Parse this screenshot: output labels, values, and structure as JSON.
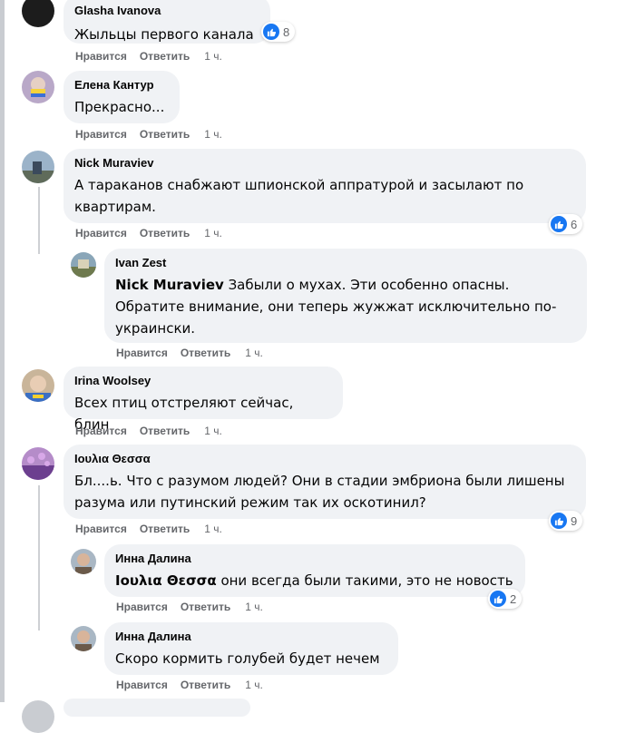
{
  "ui": {
    "like": "Нравится",
    "reply": "Ответить",
    "time": "1 ч."
  },
  "colors": {
    "like_blue": "#1877f2",
    "bubble_bg": "#f0f2f5",
    "meta_gray": "#65676b"
  },
  "comments": [
    {
      "author": "Glasha Ivanova",
      "text": "Жыльцы первого канала",
      "reactions": "8",
      "reaction_icon": "like-icon",
      "time": "1 ч."
    },
    {
      "author": "Елена Кантур",
      "text": "Прекрасно...",
      "time": "1 ч."
    },
    {
      "author": "Nick Muraviev",
      "text": "А тараканов снабжают шпионской аппратурой и засылают по квартирам.",
      "reactions": "6",
      "reaction_icon": "like-icon",
      "time": "1 ч."
    },
    {
      "author": "Ivan Zest",
      "mention": "Nick Muraviev",
      "text": "Забыли о мухах. Эти особенно опасны. Обратите внимание, они теперь жужжат исключительно по-украински.",
      "time": "1 ч."
    },
    {
      "author": "Irina Woolsey",
      "text": "Всех птиц отстреляют сейчас, блин",
      "time": "1 ч."
    },
    {
      "author": "Ιουλια Θεσσα",
      "text": "Бл....ь. Что с разумом людей? Они в стадии эмбриона были лишены разума или путинский режим так их оскотинил?",
      "reactions": "9",
      "reaction_icon": "like-icon",
      "time": "1 ч."
    },
    {
      "author": "Инна Далина",
      "mention": "Ιουλια Θεσσα",
      "text": "они всегда были такими, это не новость",
      "reactions": "2",
      "reaction_icon": "like-icon",
      "time": "1 ч."
    },
    {
      "author": "Инна Далина",
      "text": "Скоро кормить голубей будет нечем",
      "time": "1 ч."
    }
  ]
}
